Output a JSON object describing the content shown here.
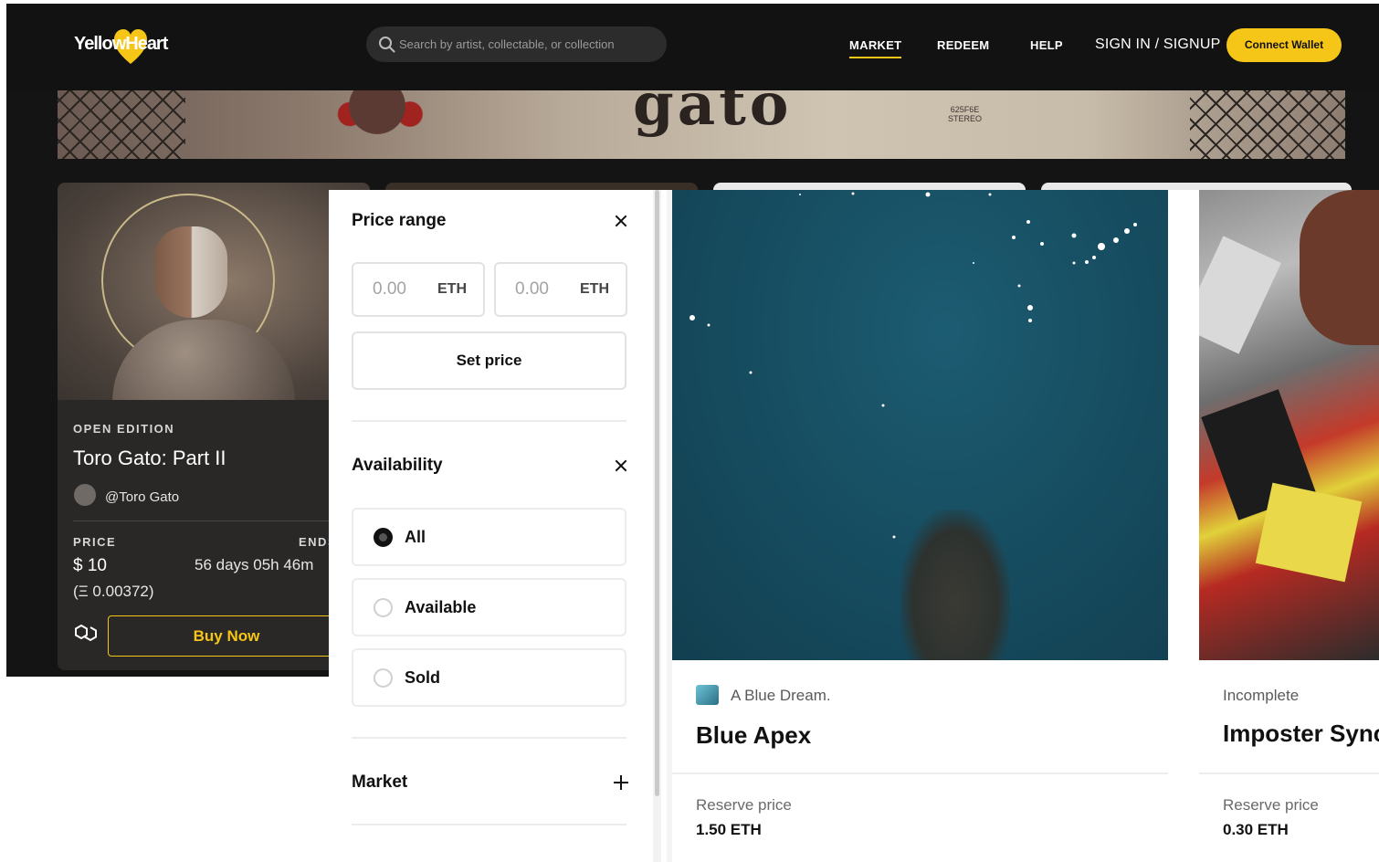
{
  "header": {
    "logo_text": "YellowHeart",
    "search_placeholder": "Search by artist, collectable, or collection",
    "nav": {
      "market": "MARKET",
      "redeem": "REDEEM",
      "help": "HELP",
      "signin": "SIGN IN / SIGNUP"
    },
    "connect_wallet": "Connect Wallet",
    "accent_color": "#f5c518"
  },
  "banner": {
    "title_fragment": "gato",
    "label_line1": "625F6E",
    "label_line2": "STEREO"
  },
  "featured_card": {
    "edition": "OPEN EDITION",
    "title": "Toro Gato: Part II",
    "artist": "@Toro Gato",
    "price_label": "PRICE",
    "ends_label": "ENDS",
    "price": "$ 10",
    "price_eth": "(Ξ 0.00372)",
    "time_left": "56 days 05h 46m",
    "buy_label": "Buy Now"
  },
  "filters": {
    "price_range": {
      "title": "Price range",
      "min_value": "0.00",
      "max_value": "0.00",
      "unit": "ETH",
      "set_price_label": "Set price"
    },
    "availability": {
      "title": "Availability",
      "options": [
        "All",
        "Available",
        "Sold"
      ],
      "selected": "All"
    },
    "market": {
      "title": "Market"
    }
  },
  "nft_cards": [
    {
      "creator": "A Blue Dream.",
      "title": "Blue Apex",
      "reserve_label": "Reserve price",
      "reserve_value": "1.50 ETH"
    },
    {
      "creator": "Incomplete",
      "title": "Imposter Sync",
      "reserve_label": "Reserve price",
      "reserve_value": "0.30 ETH"
    }
  ]
}
